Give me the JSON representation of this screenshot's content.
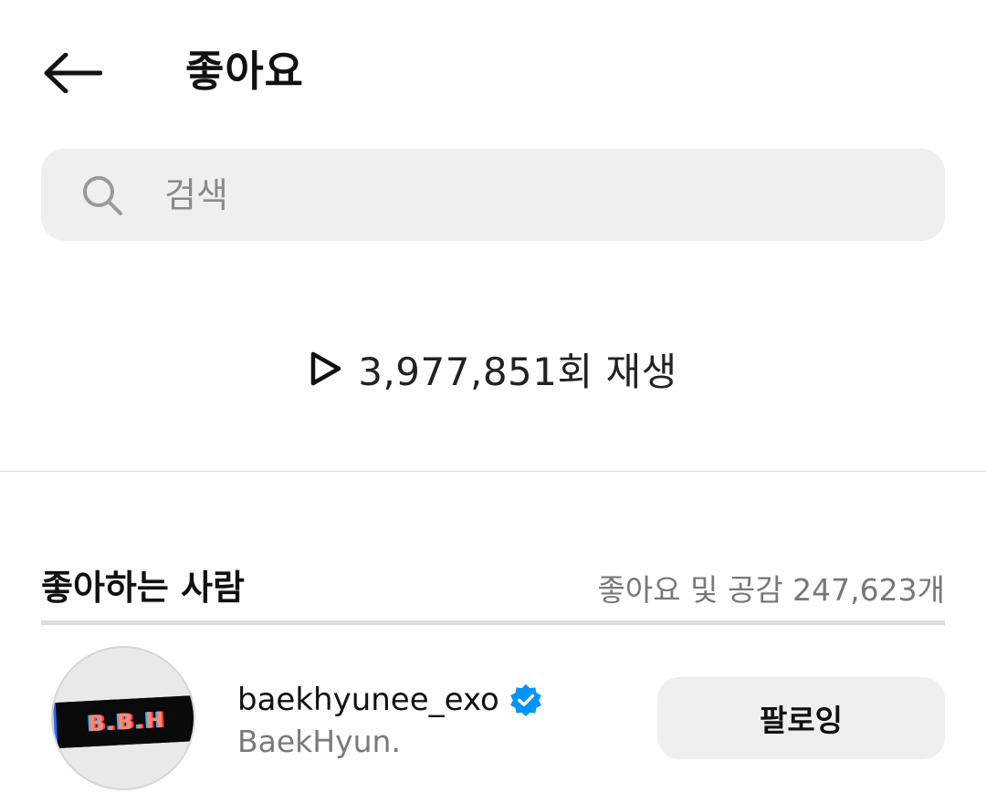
{
  "header": {
    "title": "좋아요",
    "back_icon": "arrow-left-icon"
  },
  "search": {
    "placeholder": "검색",
    "value": "",
    "icon": "search-icon"
  },
  "stats": {
    "plays_label": "3,977,851회 재생",
    "play_icon": "play-icon"
  },
  "likers_section": {
    "title": "좋아하는 사람",
    "count_label": "좋아요 및 공감 247,623개"
  },
  "users": [
    {
      "avatar_text": "B.B.H",
      "username": "baekhyunee_exo",
      "verified": true,
      "full_name": "BaekHyun.",
      "follow_label": "팔로잉"
    }
  ],
  "colors": {
    "background": "#ffffff",
    "search_bg": "#efefef",
    "button_bg": "#efefef",
    "verified_blue": "#0095f6",
    "secondary_text": "#7a7a7a"
  }
}
